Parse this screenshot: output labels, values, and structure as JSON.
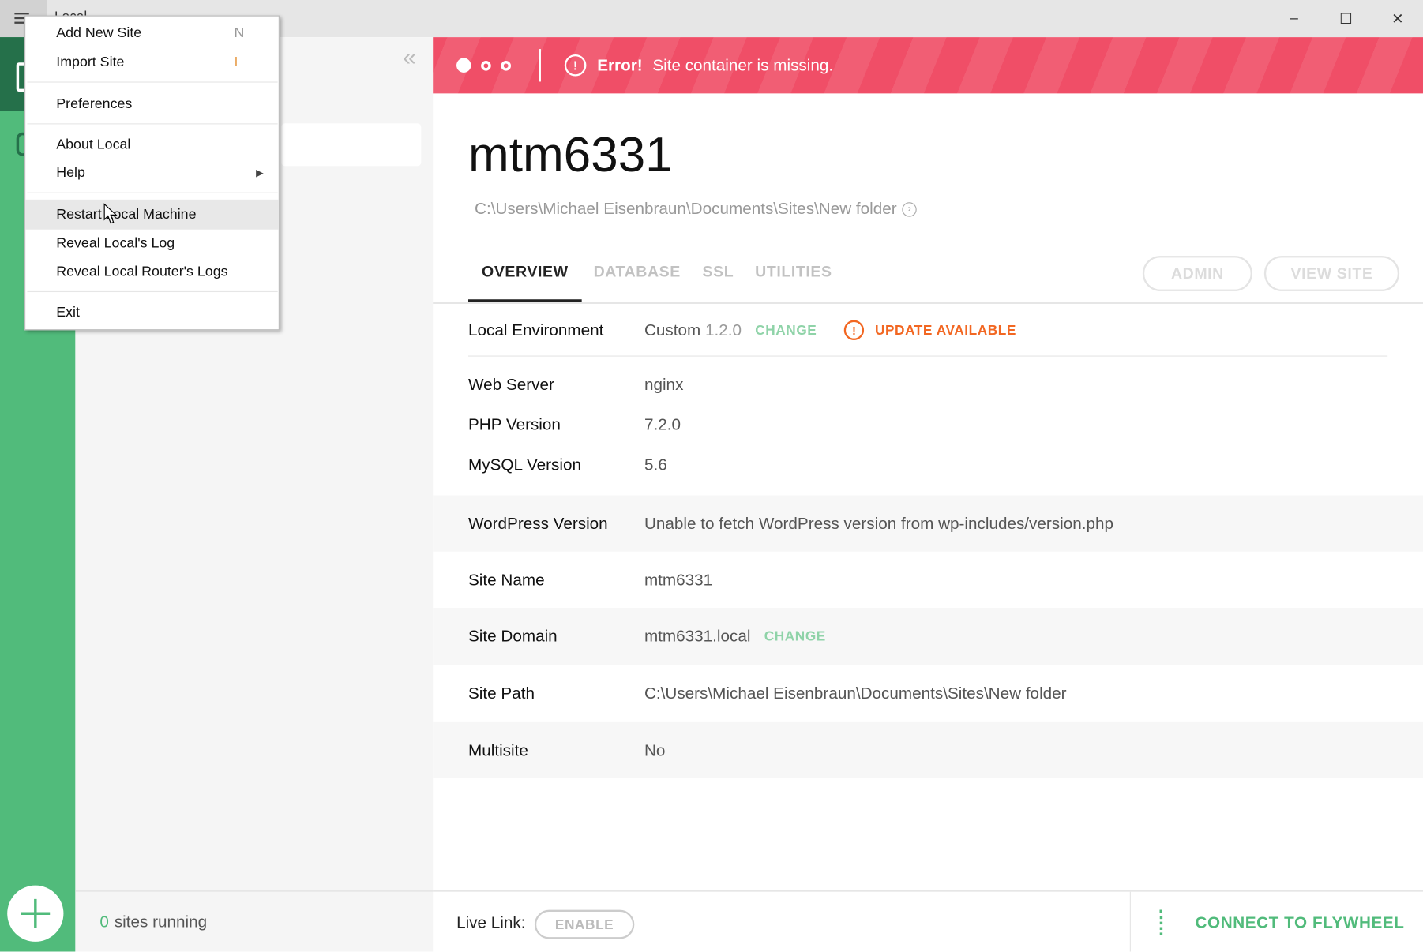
{
  "window": {
    "title": "Local",
    "minimize": "–",
    "maximize": "☐",
    "close": "✕"
  },
  "menu": {
    "items": [
      {
        "label": "Add New Site",
        "shortcut": "N"
      },
      {
        "label": "Import Site",
        "shortcut": "I"
      },
      {
        "label": "Preferences"
      },
      {
        "label": "About Local"
      },
      {
        "label": "Help",
        "submenu": "▶"
      },
      {
        "label": "Restart Local Machine"
      },
      {
        "label": "Reveal Local's Log"
      },
      {
        "label": "Reveal Local Router's Logs"
      },
      {
        "label": "Exit"
      }
    ]
  },
  "sidebar": {
    "collapse": "«",
    "sites_running_count": "0",
    "sites_running_label": "sites running"
  },
  "banner": {
    "error_label": "Error!",
    "message": "Site container is missing."
  },
  "site": {
    "name": "mtm6331",
    "path": "C:\\Users\\Michael Eisenbraun\\Documents\\Sites\\New folder"
  },
  "tabs": [
    "OVERVIEW",
    "DATABASE",
    "SSL",
    "UTILITIES"
  ],
  "buttons": {
    "admin": "ADMIN",
    "view_site": "VIEW SITE"
  },
  "overview": {
    "env_label": "Local Environment",
    "env_value": "Custom",
    "env_version": "1.2.0",
    "env_change": "CHANGE",
    "update": "UPDATE AVAILABLE",
    "rows": [
      {
        "k": "Web Server",
        "v": "nginx"
      },
      {
        "k": "PHP Version",
        "v": "7.2.0"
      },
      {
        "k": "MySQL Version",
        "v": "5.6"
      },
      {
        "k": "WordPress Version",
        "v": "Unable to fetch WordPress version from wp-includes/version.php"
      },
      {
        "k": "Site Name",
        "v": "mtm6331"
      },
      {
        "k": "Site Domain",
        "v": "mtm6331.local",
        "change": "CHANGE"
      },
      {
        "k": "Site Path",
        "v": "C:\\Users\\Michael Eisenbraun\\Documents\\Sites\\New folder"
      },
      {
        "k": "Multisite",
        "v": "No"
      }
    ]
  },
  "footer": {
    "live_link": "Live Link:",
    "enable": "ENABLE",
    "connect": "CONNECT TO FLYWHEEL"
  },
  "colors": {
    "green": "#51bb7b",
    "error": "#f04e67",
    "orange": "#f26722"
  }
}
